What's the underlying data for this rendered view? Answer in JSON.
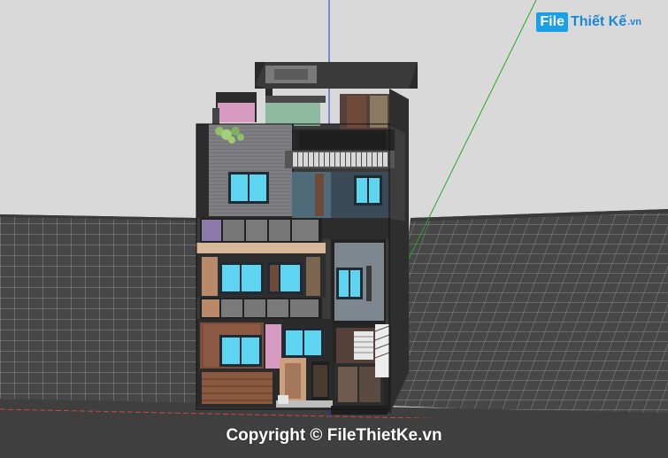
{
  "watermark": {
    "brand_part1": "File",
    "brand_part2": "Thiết Kế",
    "brand_suffix": ".vn"
  },
  "copyright_text": "Copyright © FileThietKe.vn",
  "colors": {
    "sky": "#d9d9d9",
    "roof_tile": "#4a4a4a",
    "roof_line": "#9a9a9a",
    "red_axis": "#d04040",
    "green_axis": "#24a824",
    "blue_axis": "#2233cc"
  }
}
